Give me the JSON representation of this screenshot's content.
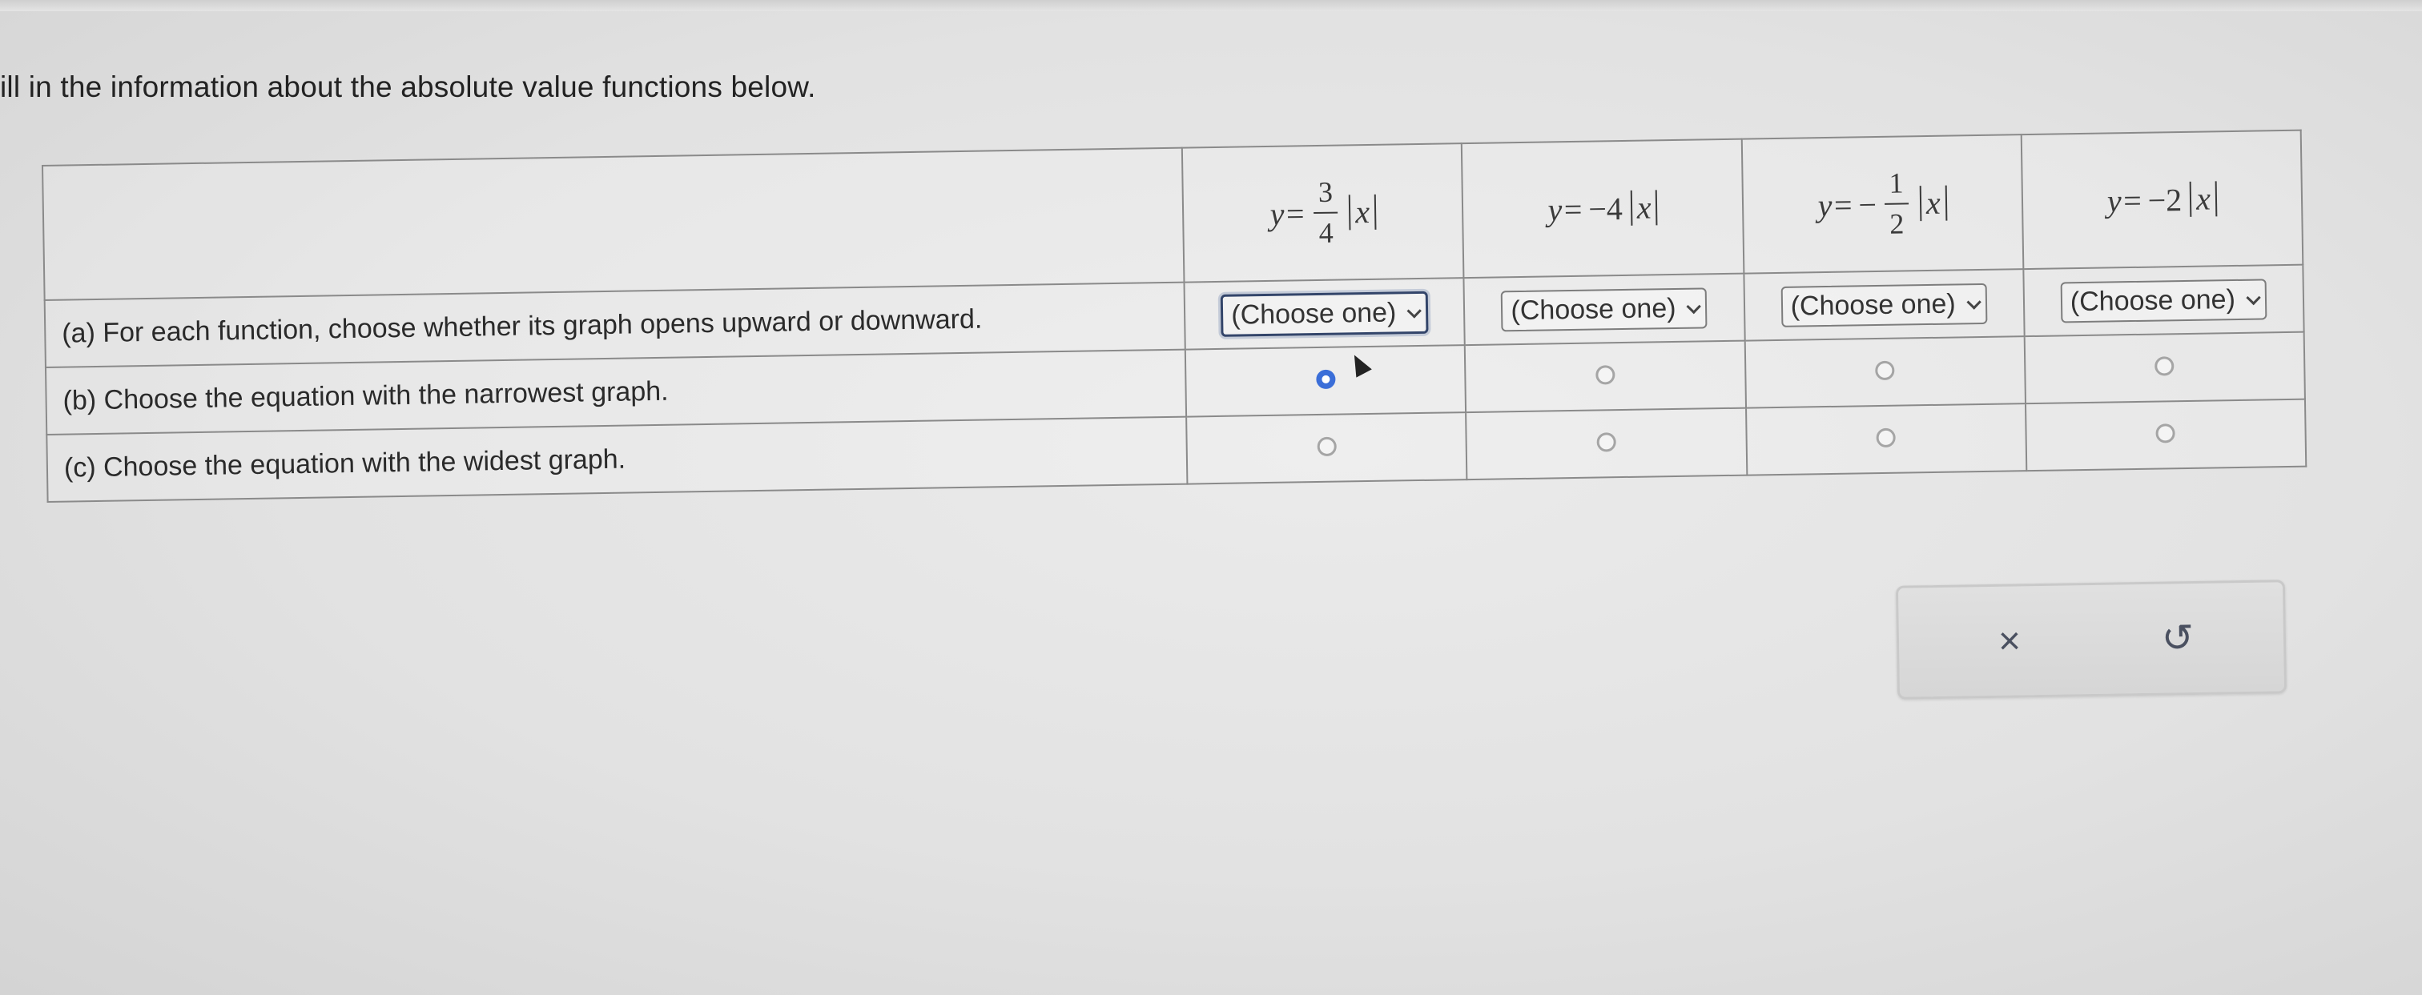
{
  "instructions": "ill in the information about the absolute value functions below.",
  "functions": [
    {
      "prefix": "y=",
      "coef": "",
      "frac_num": "3",
      "frac_den": "4",
      "abs_var": "x"
    },
    {
      "prefix": "y=",
      "coef": "−4",
      "frac_num": "",
      "frac_den": "",
      "abs_var": "x"
    },
    {
      "prefix": "y=",
      "coef": "−",
      "frac_num": "1",
      "frac_den": "2",
      "abs_var": "x"
    },
    {
      "prefix": "y=",
      "coef": "−2",
      "frac_num": "",
      "frac_den": "",
      "abs_var": "x"
    }
  ],
  "rows": {
    "a": "(a) For each function, choose whether its graph opens upward or downward.",
    "b": "(b) Choose the equation with the narrowest graph.",
    "c": "(c) Choose the equation with the widest graph."
  },
  "select_values": [
    "(Choose one)",
    "(Choose one)",
    "(Choose one)",
    "(Choose one)"
  ],
  "narrowest_selected_index": 0,
  "widest_selected_index": null,
  "actions": {
    "clear_icon": "×",
    "undo_icon": "↺"
  },
  "colors": {
    "radio_selected": "#3b6ed8",
    "focus_border": "#33456a"
  }
}
